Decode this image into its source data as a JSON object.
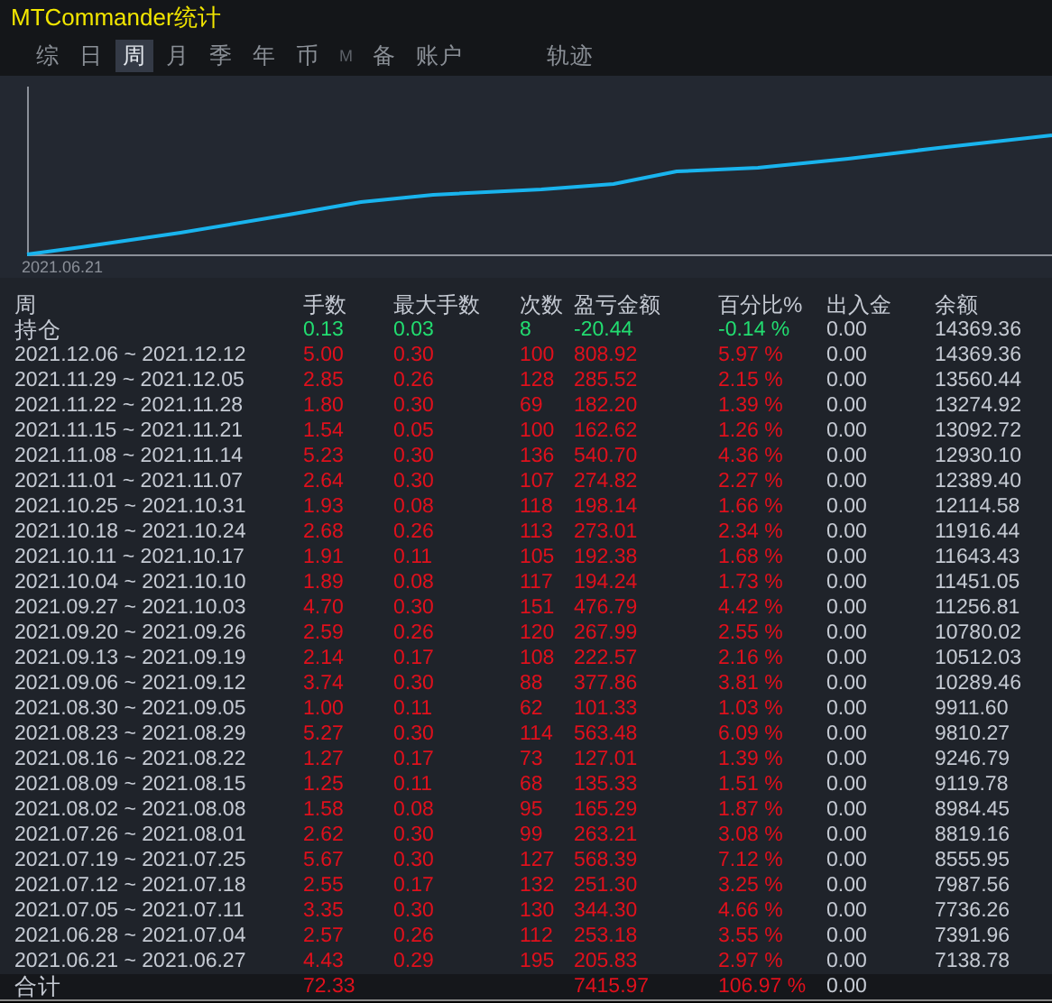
{
  "window": {
    "title": "MTCommander统计"
  },
  "tabs": [
    {
      "label": "综",
      "selected": false,
      "disabled": false
    },
    {
      "label": "日",
      "selected": false,
      "disabled": false
    },
    {
      "label": "周",
      "selected": true,
      "disabled": false
    },
    {
      "label": "月",
      "selected": false,
      "disabled": false
    },
    {
      "label": "季",
      "selected": false,
      "disabled": false
    },
    {
      "label": "年",
      "selected": false,
      "disabled": false
    },
    {
      "label": "币",
      "selected": false,
      "disabled": false
    },
    {
      "label": "M",
      "selected": false,
      "disabled": true
    },
    {
      "label": "备",
      "selected": false,
      "disabled": false
    },
    {
      "label": "账户",
      "selected": false,
      "disabled": false
    }
  ],
  "side_tab": {
    "label": "轨迹",
    "selected": false
  },
  "equity_chart": {
    "start_label": "2021.06.21"
  },
  "table": {
    "columns": [
      "周",
      "手数",
      "最大手数",
      "次数",
      "盈亏金额",
      "百分比%",
      "出入金",
      "余额"
    ],
    "rows": [
      {
        "period": "持仓",
        "lots": "0.13",
        "max_lots": "0.03",
        "trades": "8",
        "pnl": "-20.44",
        "percent": "-0.14 %",
        "cash_flow": "0.00",
        "balance": "14369.36",
        "color": "#22dd70"
      },
      {
        "period": "2021.12.06 ~ 2021.12.12",
        "lots": "5.00",
        "max_lots": "0.30",
        "trades": "100",
        "pnl": "808.92",
        "percent": "5.97 %",
        "cash_flow": "0.00",
        "balance": "14369.36",
        "color": "#e0101c"
      },
      {
        "period": "2021.11.29 ~ 2021.12.05",
        "lots": "2.85",
        "max_lots": "0.26",
        "trades": "128",
        "pnl": "285.52",
        "percent": "2.15 %",
        "cash_flow": "0.00",
        "balance": "13560.44",
        "color": "#e0101c"
      },
      {
        "period": "2021.11.22 ~ 2021.11.28",
        "lots": "1.80",
        "max_lots": "0.30",
        "trades": "69",
        "pnl": "182.20",
        "percent": "1.39 %",
        "cash_flow": "0.00",
        "balance": "13274.92",
        "color": "#e0101c"
      },
      {
        "period": "2021.11.15 ~ 2021.11.21",
        "lots": "1.54",
        "max_lots": "0.05",
        "trades": "100",
        "pnl": "162.62",
        "percent": "1.26 %",
        "cash_flow": "0.00",
        "balance": "13092.72",
        "color": "#e0101c"
      },
      {
        "period": "2021.11.08 ~ 2021.11.14",
        "lots": "5.23",
        "max_lots": "0.30",
        "trades": "136",
        "pnl": "540.70",
        "percent": "4.36 %",
        "cash_flow": "0.00",
        "balance": "12930.10",
        "color": "#e0101c"
      },
      {
        "period": "2021.11.01 ~ 2021.11.07",
        "lots": "2.64",
        "max_lots": "0.30",
        "trades": "107",
        "pnl": "274.82",
        "percent": "2.27 %",
        "cash_flow": "0.00",
        "balance": "12389.40",
        "color": "#e0101c"
      },
      {
        "period": "2021.10.25 ~ 2021.10.31",
        "lots": "1.93",
        "max_lots": "0.08",
        "trades": "118",
        "pnl": "198.14",
        "percent": "1.66 %",
        "cash_flow": "0.00",
        "balance": "12114.58",
        "color": "#e0101c"
      },
      {
        "period": "2021.10.18 ~ 2021.10.24",
        "lots": "2.68",
        "max_lots": "0.26",
        "trades": "113",
        "pnl": "273.01",
        "percent": "2.34 %",
        "cash_flow": "0.00",
        "balance": "11916.44",
        "color": "#e0101c"
      },
      {
        "period": "2021.10.11 ~ 2021.10.17",
        "lots": "1.91",
        "max_lots": "0.11",
        "trades": "105",
        "pnl": "192.38",
        "percent": "1.68 %",
        "cash_flow": "0.00",
        "balance": "11643.43",
        "color": "#e0101c"
      },
      {
        "period": "2021.10.04 ~ 2021.10.10",
        "lots": "1.89",
        "max_lots": "0.08",
        "trades": "117",
        "pnl": "194.24",
        "percent": "1.73 %",
        "cash_flow": "0.00",
        "balance": "11451.05",
        "color": "#e0101c"
      },
      {
        "period": "2021.09.27 ~ 2021.10.03",
        "lots": "4.70",
        "max_lots": "0.30",
        "trades": "151",
        "pnl": "476.79",
        "percent": "4.42 %",
        "cash_flow": "0.00",
        "balance": "11256.81",
        "color": "#e0101c"
      },
      {
        "period": "2021.09.20 ~ 2021.09.26",
        "lots": "2.59",
        "max_lots": "0.26",
        "trades": "120",
        "pnl": "267.99",
        "percent": "2.55 %",
        "cash_flow": "0.00",
        "balance": "10780.02",
        "color": "#e0101c"
      },
      {
        "period": "2021.09.13 ~ 2021.09.19",
        "lots": "2.14",
        "max_lots": "0.17",
        "trades": "108",
        "pnl": "222.57",
        "percent": "2.16 %",
        "cash_flow": "0.00",
        "balance": "10512.03",
        "color": "#e0101c"
      },
      {
        "period": "2021.09.06 ~ 2021.09.12",
        "lots": "3.74",
        "max_lots": "0.30",
        "trades": "88",
        "pnl": "377.86",
        "percent": "3.81 %",
        "cash_flow": "0.00",
        "balance": "10289.46",
        "color": "#e0101c"
      },
      {
        "period": "2021.08.30 ~ 2021.09.05",
        "lots": "1.00",
        "max_lots": "0.11",
        "trades": "62",
        "pnl": "101.33",
        "percent": "1.03 %",
        "cash_flow": "0.00",
        "balance": "9911.60",
        "color": "#e0101c"
      },
      {
        "period": "2021.08.23 ~ 2021.08.29",
        "lots": "5.27",
        "max_lots": "0.30",
        "trades": "114",
        "pnl": "563.48",
        "percent": "6.09 %",
        "cash_flow": "0.00",
        "balance": "9810.27",
        "color": "#e0101c"
      },
      {
        "period": "2021.08.16 ~ 2021.08.22",
        "lots": "1.27",
        "max_lots": "0.17",
        "trades": "73",
        "pnl": "127.01",
        "percent": "1.39 %",
        "cash_flow": "0.00",
        "balance": "9246.79",
        "color": "#e0101c"
      },
      {
        "period": "2021.08.09 ~ 2021.08.15",
        "lots": "1.25",
        "max_lots": "0.11",
        "trades": "68",
        "pnl": "135.33",
        "percent": "1.51 %",
        "cash_flow": "0.00",
        "balance": "9119.78",
        "color": "#e0101c"
      },
      {
        "period": "2021.08.02 ~ 2021.08.08",
        "lots": "1.58",
        "max_lots": "0.08",
        "trades": "95",
        "pnl": "165.29",
        "percent": "1.87 %",
        "cash_flow": "0.00",
        "balance": "8984.45",
        "color": "#e0101c"
      },
      {
        "period": "2021.07.26 ~ 2021.08.01",
        "lots": "2.62",
        "max_lots": "0.30",
        "trades": "99",
        "pnl": "263.21",
        "percent": "3.08 %",
        "cash_flow": "0.00",
        "balance": "8819.16",
        "color": "#e0101c"
      },
      {
        "period": "2021.07.19 ~ 2021.07.25",
        "lots": "5.67",
        "max_lots": "0.30",
        "trades": "127",
        "pnl": "568.39",
        "percent": "7.12 %",
        "cash_flow": "0.00",
        "balance": "8555.95",
        "color": "#e0101c"
      },
      {
        "period": "2021.07.12 ~ 2021.07.18",
        "lots": "2.55",
        "max_lots": "0.17",
        "trades": "132",
        "pnl": "251.30",
        "percent": "3.25 %",
        "cash_flow": "0.00",
        "balance": "7987.56",
        "color": "#e0101c"
      },
      {
        "period": "2021.07.05 ~ 2021.07.11",
        "lots": "3.35",
        "max_lots": "0.30",
        "trades": "130",
        "pnl": "344.30",
        "percent": "4.66 %",
        "cash_flow": "0.00",
        "balance": "7736.26",
        "color": "#e0101c"
      },
      {
        "period": "2021.06.28 ~ 2021.07.04",
        "lots": "2.57",
        "max_lots": "0.26",
        "trades": "112",
        "pnl": "253.18",
        "percent": "3.55 %",
        "cash_flow": "0.00",
        "balance": "7391.96",
        "color": "#e0101c"
      },
      {
        "period": "2021.06.21 ~ 2021.06.27",
        "lots": "4.43",
        "max_lots": "0.29",
        "trades": "195",
        "pnl": "205.83",
        "percent": "2.97 %",
        "cash_flow": "0.00",
        "balance": "7138.78",
        "color": "#e0101c"
      }
    ],
    "total": {
      "label": "合计",
      "lots": "72.33",
      "pnl": "7415.97",
      "percent": "106.97 %",
      "cash_flow": "0.00",
      "color": "#e0101c"
    }
  }
}
